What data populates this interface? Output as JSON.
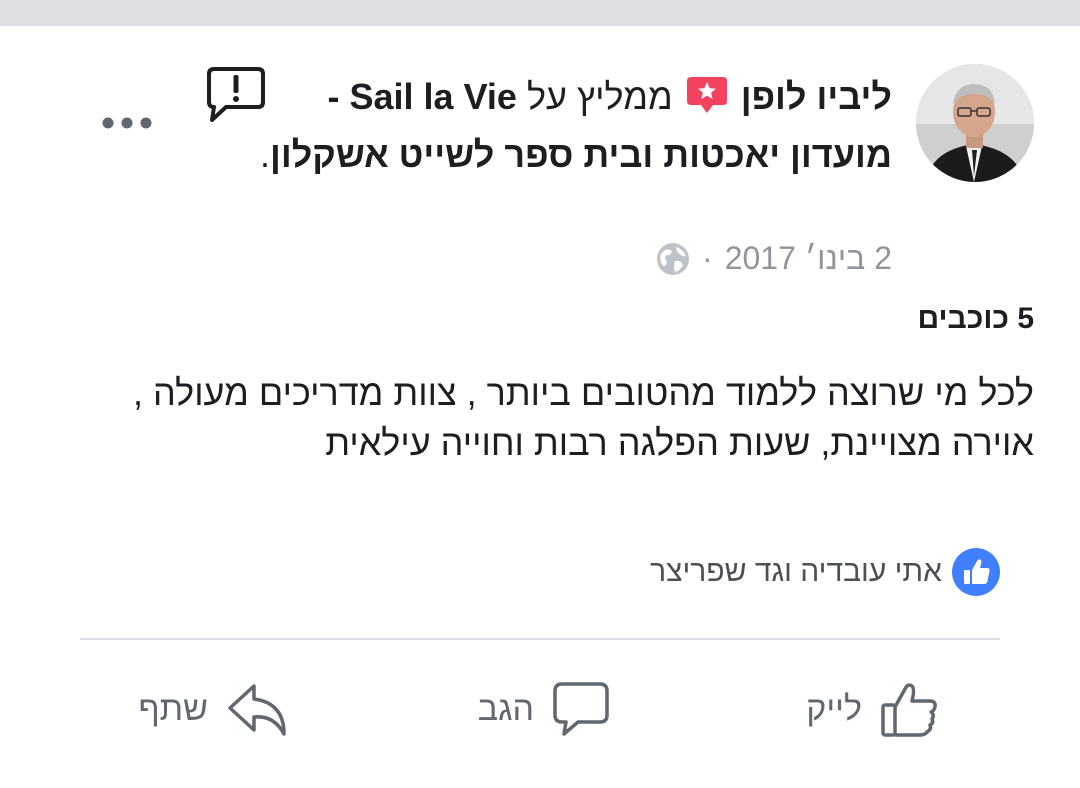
{
  "post": {
    "author": "ליביו לופן",
    "recommends": "ממליץ על",
    "page_name_latin": "Sail la Vie",
    "page_name_rest": "- מועדון יאכטות ובית ספר לשייט אשקלון",
    "period": ".",
    "date": "2 בינו׳ 2017",
    "separator": "·",
    "icons": {
      "avatar": "user-avatar",
      "recommend": "recommend-badge-icon",
      "privacy": "globe-icon",
      "report": "report-alert-icon",
      "more": "more-options-icon"
    }
  },
  "review": {
    "stars": "5 כוכבים",
    "text": "לכל מי שרוצה ללמוד מהטובים ביותר , צוות מדריכים מעולה , אוירה מצויינת, שעות הפלגה רבות וחוייה עילאית"
  },
  "reactions": {
    "names": "אתי עובדיה וגד שפריצר",
    "icon": "like-reaction-icon"
  },
  "actions": {
    "like": "לייק",
    "comment": "הגב",
    "share": "שתף"
  },
  "colors": {
    "brand_blue": "#4080ff",
    "badge_red": "#f3425f",
    "muted_text": "#90949c",
    "action_gray": "#606770",
    "divider": "#dddfe2"
  }
}
